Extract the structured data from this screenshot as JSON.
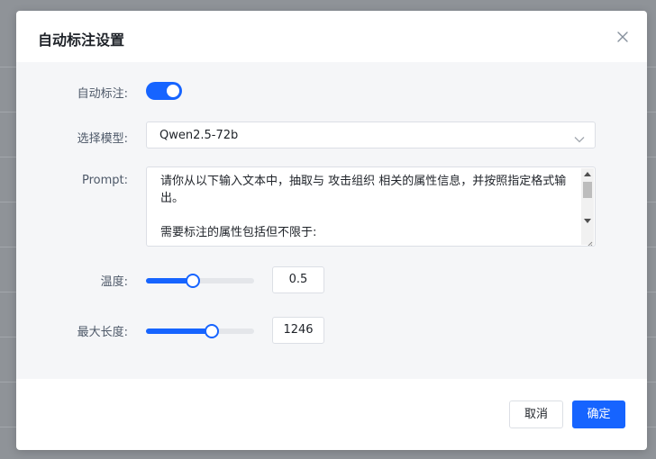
{
  "dialog": {
    "title": "自动标注设置",
    "close_icon": "close-icon"
  },
  "form": {
    "auto_label": {
      "label": "自动标注:",
      "enabled": true,
      "accent_color": "#1664ff"
    },
    "model": {
      "label": "选择模型:",
      "value": "Qwen2.5-72b"
    },
    "prompt": {
      "label": "Prompt:",
      "value": "请你从以下输入文本中，抽取与 攻击组织 相关的属性信息，并按照指定格式输出。\n\n需要标注的属性包括但不限于:"
    },
    "temperature": {
      "label": "温度:",
      "value": "0.5",
      "level": 0.43
    },
    "max_length": {
      "label": "最大长度:",
      "value": "1246",
      "level": 0.61
    }
  },
  "footer": {
    "cancel_label": "取消",
    "ok_label": "确定"
  }
}
